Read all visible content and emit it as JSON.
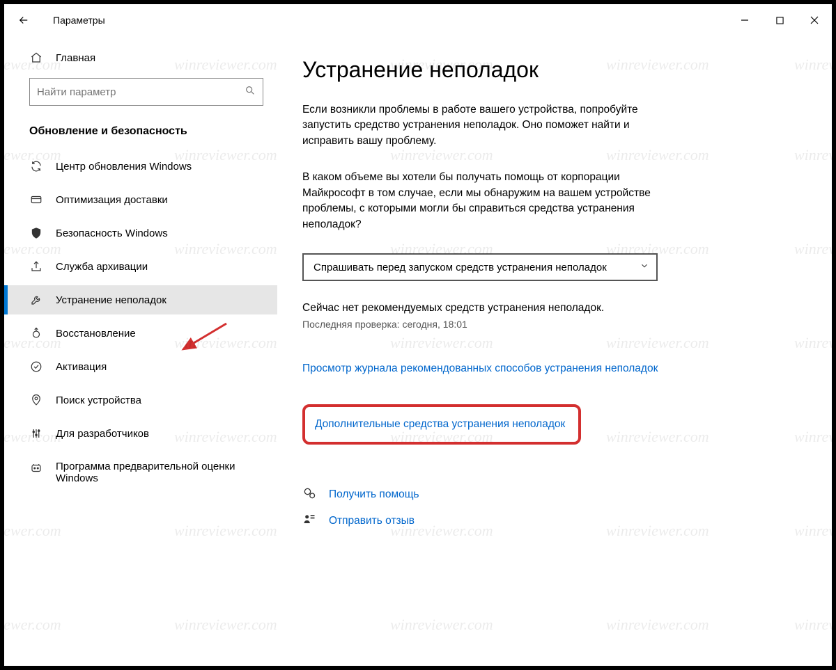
{
  "titlebar": {
    "title": "Параметры"
  },
  "sidebar": {
    "home_label": "Главная",
    "search_placeholder": "Найти параметр",
    "section_title": "Обновление и безопасность",
    "items": [
      {
        "label": "Центр обновления Windows"
      },
      {
        "label": "Оптимизация доставки"
      },
      {
        "label": "Безопасность Windows"
      },
      {
        "label": "Служба архивации"
      },
      {
        "label": "Устранение неполадок"
      },
      {
        "label": "Восстановление"
      },
      {
        "label": "Активация"
      },
      {
        "label": "Поиск устройства"
      },
      {
        "label": "Для разработчиков"
      },
      {
        "label": "Программа предварительной оценки Windows"
      }
    ]
  },
  "content": {
    "heading": "Устранение неполадок",
    "para1": "Если возникли проблемы в работе вашего устройства, попробуйте запустить средство устранения неполадок. Оно поможет найти и исправить вашу проблему.",
    "para2": "В каком объеме вы хотели бы получать помощь от корпорации Майкрософт в том случае, если мы обнаружим на вашем устройстве проблемы, с которыми могли бы справиться средства устранения неполадок?",
    "dropdown_selected": "Спрашивать перед запуском средств устранения неполадок",
    "status_none": "Сейчас нет рекомендуемых средств устранения неполадок.",
    "status_last_check": "Последняя проверка: сегодня, 18:01",
    "link_history": "Просмотр журнала рекомендованных способов устранения неполадок",
    "link_advanced": "Дополнительные средства устранения неполадок",
    "link_help": "Получить помощь",
    "link_feedback": "Отправить отзыв"
  },
  "watermark": "winreviewer.com"
}
